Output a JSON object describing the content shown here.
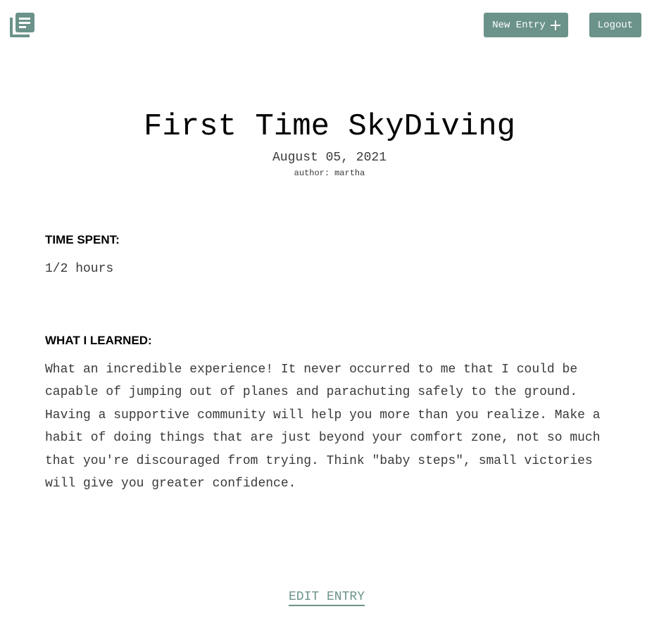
{
  "header": {
    "logo_icon": "journal-icon",
    "new_entry_label": "New Entry",
    "new_entry_icon": "plus-icon",
    "logout_label": "Logout"
  },
  "entry": {
    "title": "First Time SkyDiving",
    "date": "August 05, 2021",
    "author_prefix": "author:",
    "author_name": "martha",
    "time_spent_label": "TIME SPENT:",
    "time_spent_value": "1/2 hours",
    "learned_label": "WHAT I LEARNED:",
    "learned_text": "What an incredible experience! It never occurred to me that I could be capable of jumping out of planes and parachuting safely to the ground. Having a supportive community will help you more than you realize. Make a habit of doing things that are just beyond your comfort zone, not so much that you're discouraged from trying. Think \"baby steps\", small victories will give you greater confidence."
  },
  "footer": {
    "edit_label": "EDIT ENTRY"
  },
  "colors": {
    "accent": "#6b938a",
    "text": "#3a3a3a",
    "heading": "#000000"
  }
}
